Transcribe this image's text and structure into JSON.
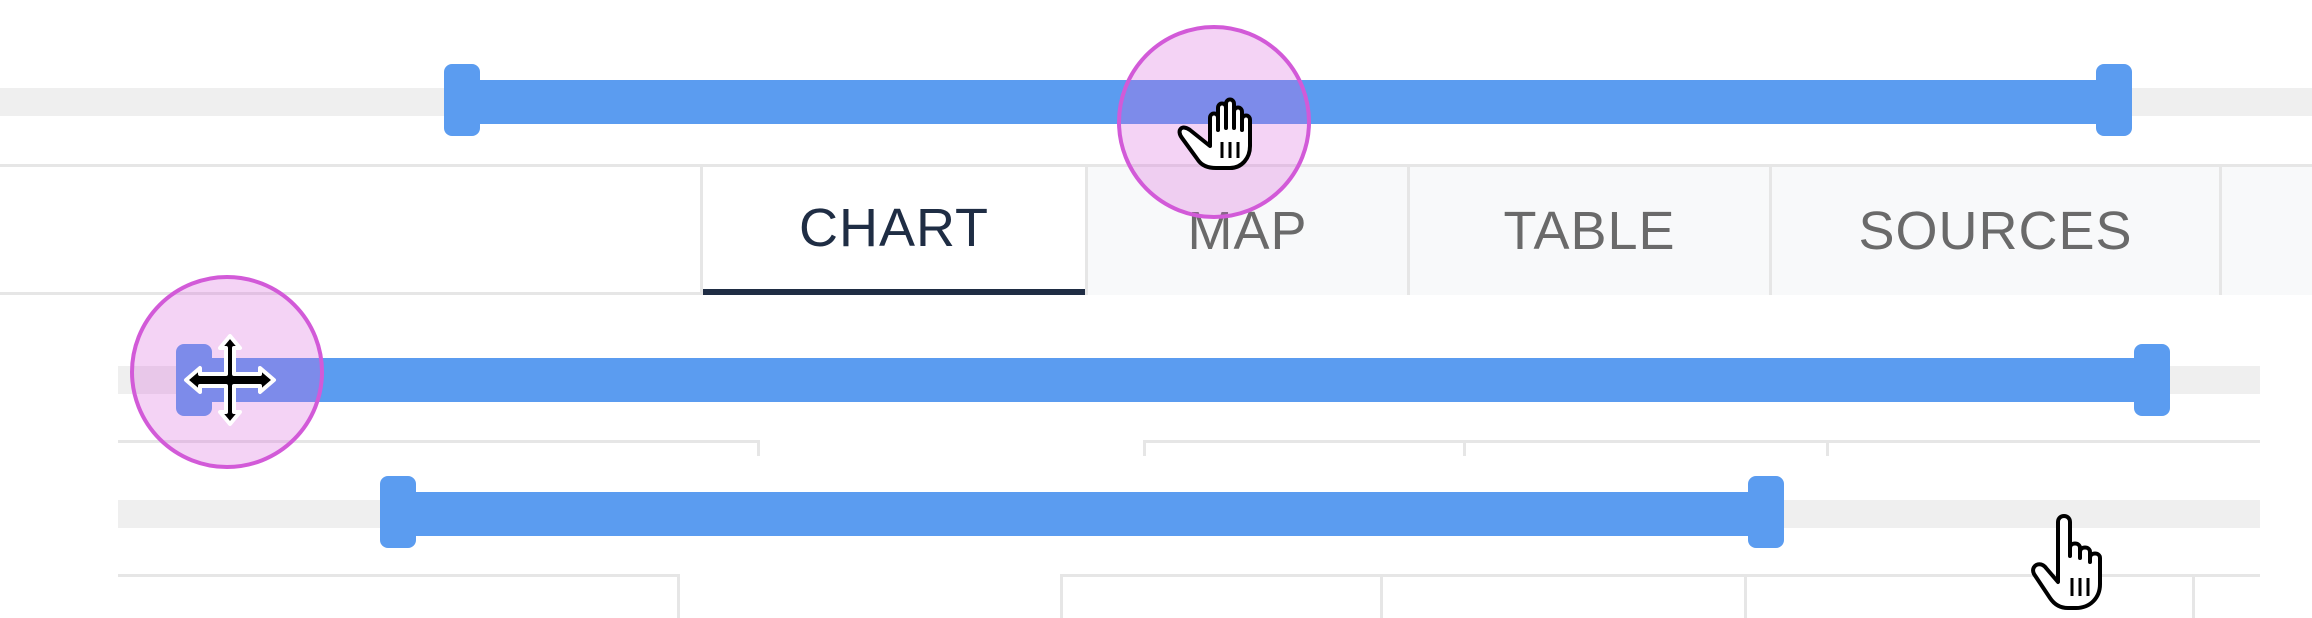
{
  "tabs": {
    "chart": "CHART",
    "map": "MAP",
    "table": "TABLE",
    "sources": "SOURCES"
  },
  "sliders": {
    "top": {
      "start_fraction": 0.2,
      "end_fraction": 0.91
    },
    "middle": {
      "start_fraction": 0.0,
      "end_fraction": 1.0
    },
    "bottom": {
      "start_fraction": 0.13,
      "end_fraction": 0.77
    }
  },
  "colors": {
    "accent": "#5b9cf0",
    "active_tab": "#1f2d44",
    "highlight": "#d25ad8"
  },
  "icons": [
    "grab-hand-icon",
    "move-cross-icon",
    "pointer-hand-icon"
  ]
}
